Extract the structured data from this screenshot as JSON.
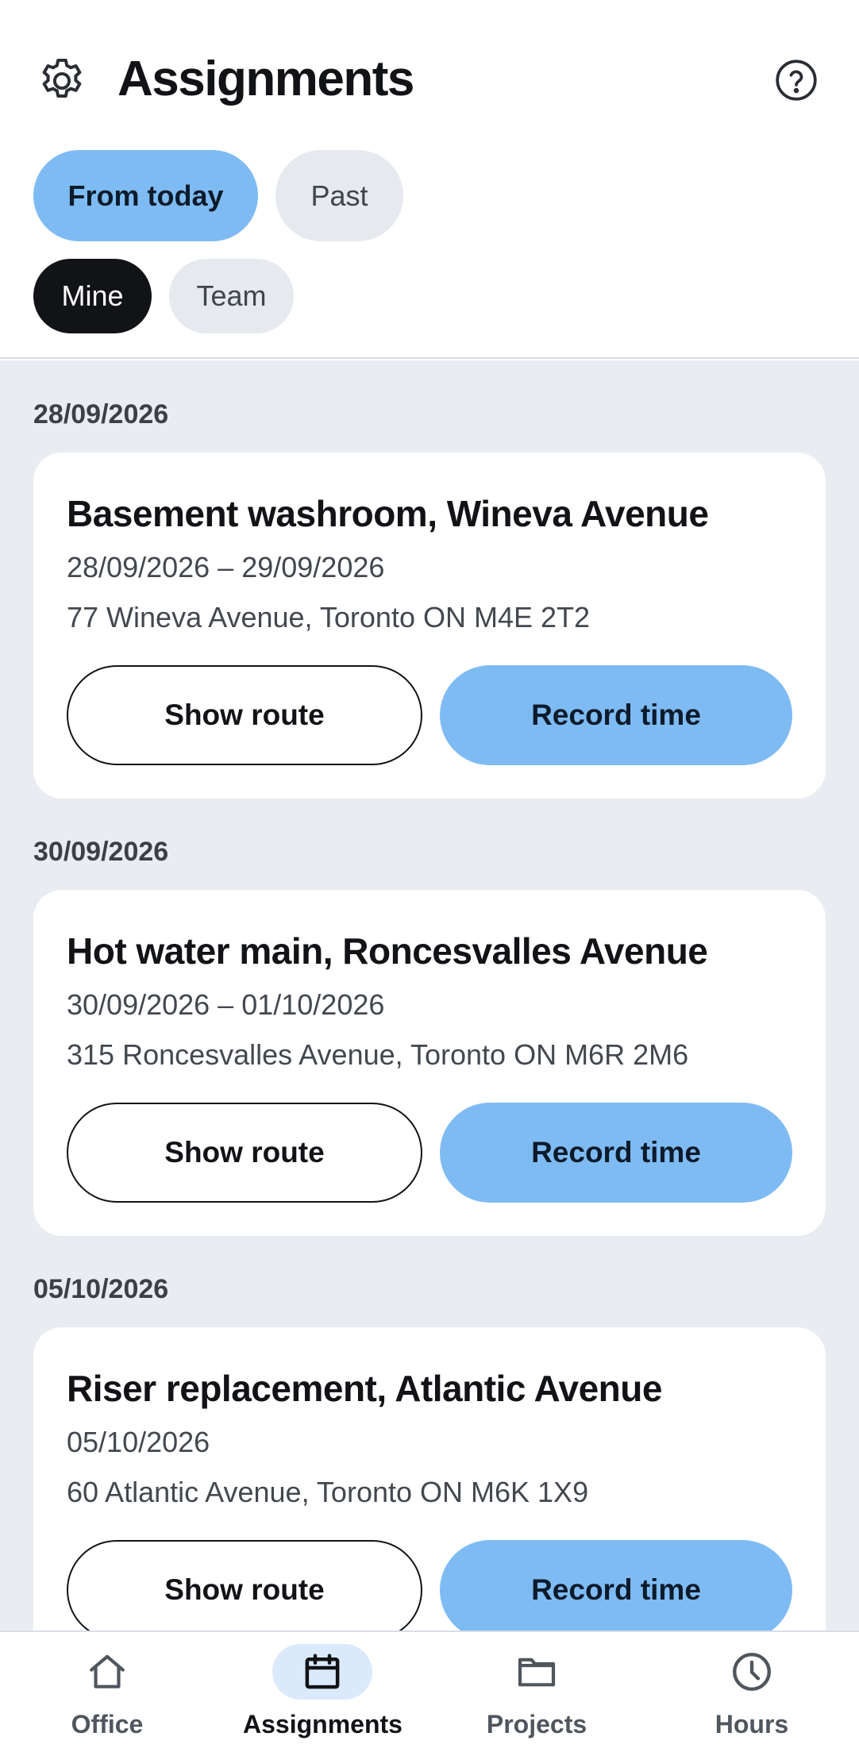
{
  "header": {
    "title": "Assignments"
  },
  "filters": {
    "period": [
      {
        "label": "From today",
        "selected": true
      },
      {
        "label": "Past",
        "selected": false
      }
    ],
    "scope": [
      {
        "label": "Mine",
        "selected": true
      },
      {
        "label": "Team",
        "selected": false
      }
    ]
  },
  "assignments": [
    {
      "date_label": "28/09/2026",
      "title": "Basement washroom, Wineva Avenue",
      "dates": "28/09/2026 – 29/09/2026",
      "address": "77 Wineva Avenue, Toronto ON M4E 2T2",
      "route_label": "Show route",
      "record_label": "Record time"
    },
    {
      "date_label": "30/09/2026",
      "title": "Hot water main, Roncesvalles Avenue",
      "dates": "30/09/2026 – 01/10/2026",
      "address": "315 Roncesvalles Avenue, Toronto ON M6R 2M6",
      "route_label": "Show route",
      "record_label": "Record time"
    },
    {
      "date_label": "05/10/2026",
      "title": "Riser replacement, Atlantic Avenue",
      "dates": "05/10/2026",
      "address": "60 Atlantic Avenue, Toronto ON M6K 1X9",
      "route_label": "Show route",
      "record_label": "Record time"
    }
  ],
  "bottom_nav": [
    {
      "label": "Office",
      "icon": "home-icon",
      "active": false
    },
    {
      "label": "Assignments",
      "icon": "calendar-icon",
      "active": true
    },
    {
      "label": "Projects",
      "icon": "folder-icon",
      "active": false
    },
    {
      "label": "Hours",
      "icon": "clock-icon",
      "active": false
    }
  ],
  "colors": {
    "accent": "#7fbbf3",
    "active_nav_pill": "#dbeafb",
    "chip_dark": "#111316",
    "chip_light": "#e6e9ed",
    "content_background": "#e9ecf0"
  }
}
